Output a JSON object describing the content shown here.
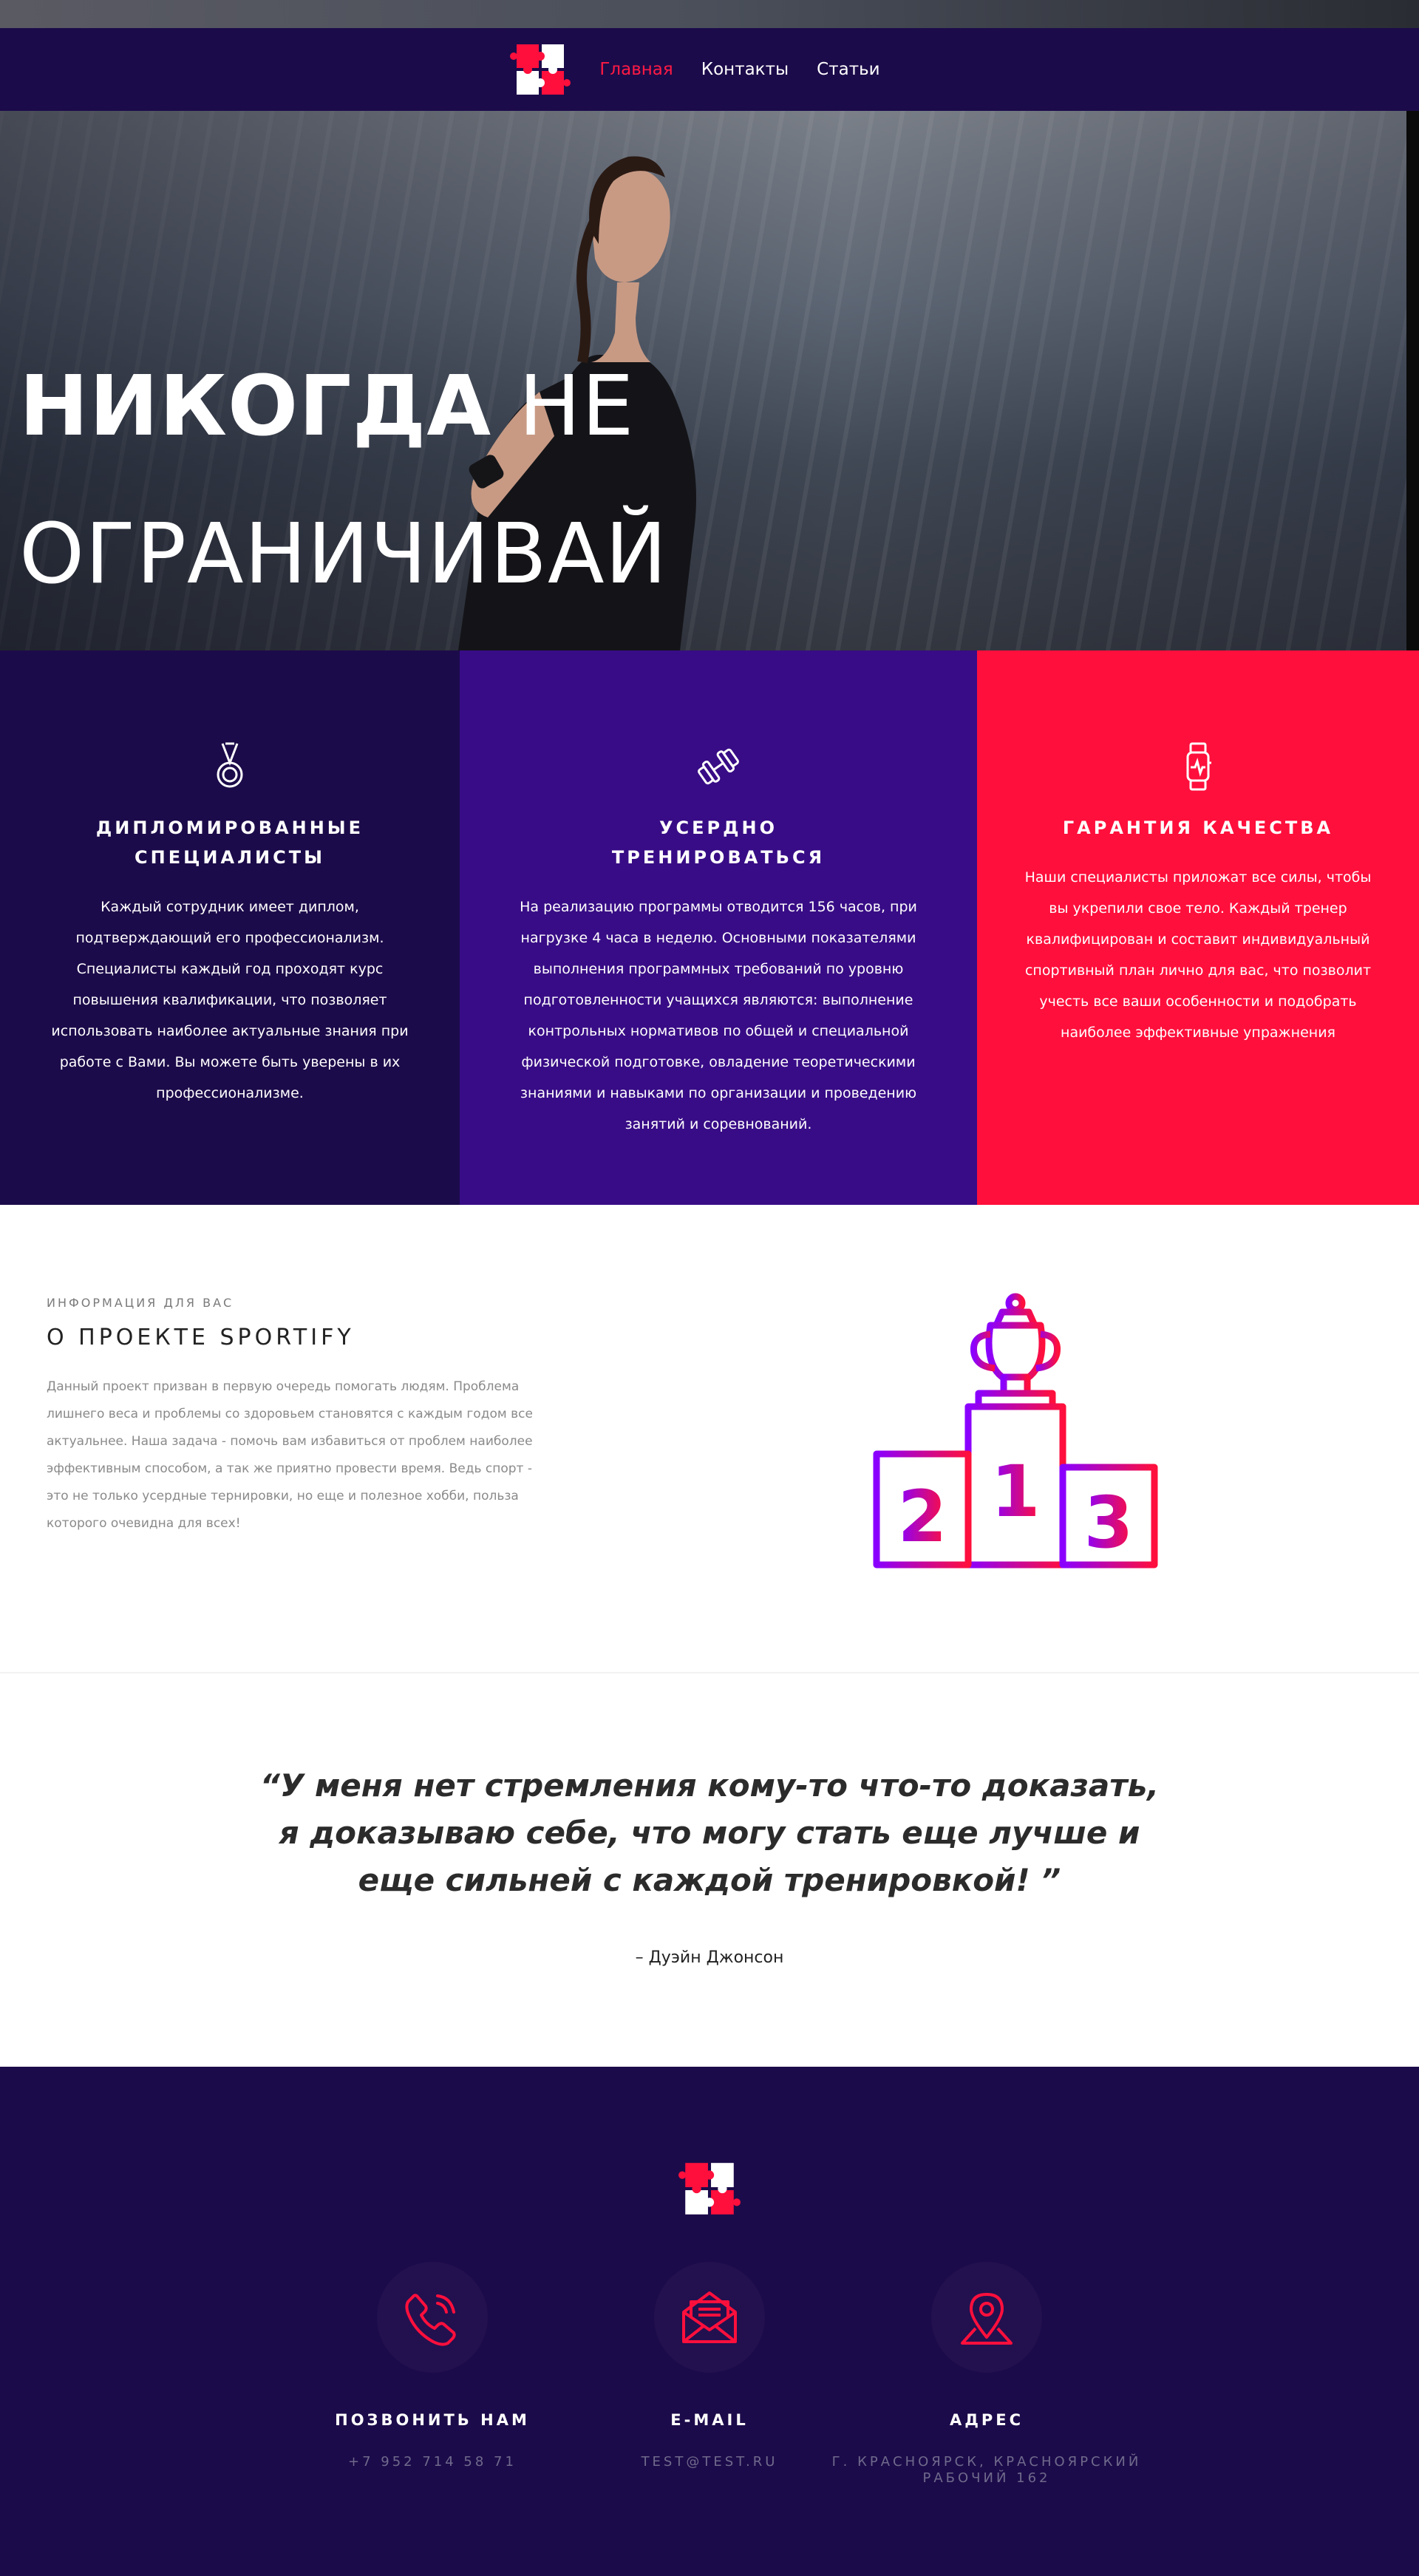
{
  "nav": {
    "items": [
      {
        "label": "Главная",
        "active": true
      },
      {
        "label": "Контакты",
        "active": false
      },
      {
        "label": "Статьи",
        "active": false
      }
    ],
    "logo_icon": "puzzle-logo-icon"
  },
  "hero": {
    "title_bold": "НИКОГДА",
    "title_rest_line1": "НЕ",
    "title_line2": "ОГРАНИЧИВАЙ"
  },
  "features": [
    {
      "icon": "medal-icon",
      "title": "ДИПЛОМИРОВАННЫЕ СПЕЦИАЛИСТЫ",
      "text": "Каждый сотрудник имеет диплом, подтверждающий его профессионализм. Специалисты каждый год проходят курс повышения квалификации, что позволяет использовать наиболее актуальные знания при работе с Вами. Вы можете быть уверены в их профессионализме."
    },
    {
      "icon": "dumbbell-icon",
      "title": "УСЕРДНО ТРЕНИРОВАТЬСЯ",
      "text": "На реализацию программы отводится 156 часов, при нагрузке 4 часа в неделю. Основными показателями выполнения программных требований по уровню подготовленности учащихся являются: выполнение контрольных нормативов по общей и специальной физической подготовке, овладение теоретическими знаниями и навыками по организации и проведению занятий и соревнований."
    },
    {
      "icon": "smartwatch-icon",
      "title": "ГАРАНТИЯ КАЧЕСТВА",
      "text": "Наши специалисты приложат все силы, чтобы вы укрепили свое тело. Каждый тренер квалифицирован и составит индивидуальный спортивный план лично для вас, что позволит учесть все ваши особенности и подобрать наиболее эффективные упражнения"
    }
  ],
  "about": {
    "kicker": "ИНФОРМАЦИЯ ДЛЯ ВАС",
    "title": "О ПРОЕКТЕ SPORTIFY",
    "text": "Данный проект призван в первую очередь помогать людям. Проблема лишнего веса и проблемы со здоровьем становятся с каждым годом все актуальнее. Наша задача - помочь вам избавиться от проблем наиболее эффективным способом, а так же приятно провести время. Ведь спорт - это не только усердные тернировки, но еще и полезное хобби, польза которого очевидна для всех!",
    "illustration": "podium-trophy-icon",
    "podium_labels": [
      "2",
      "1",
      "3"
    ]
  },
  "quote": {
    "text": "“У меня нет стремления кому-то что-то доказать, я доказываю себе, что могу стать еще лучше и еще сильней с каждой тренировкой! ”",
    "author": "– Дуэйн Джонсон"
  },
  "footer": {
    "contacts": [
      {
        "icon": "phone-icon",
        "title": "ПОЗВОНИТЬ НАМ",
        "value": "+7 952 714 58 71"
      },
      {
        "icon": "email-icon",
        "title": "E-MAIL",
        "value": "TEST@TEST.RU"
      },
      {
        "icon": "location-pin-icon",
        "title": "АДРЕС",
        "value": "Г. КРАСНОЯРСК, КРАСНОЯРСКИЙ РАБОЧИЙ 162"
      }
    ]
  },
  "colors": {
    "navy": "#1c0b4a",
    "purple": "#380c86",
    "red": "#ff0f3c",
    "accent_gradient_start": "#8a00ff",
    "accent_gradient_end": "#ff0f3c"
  }
}
